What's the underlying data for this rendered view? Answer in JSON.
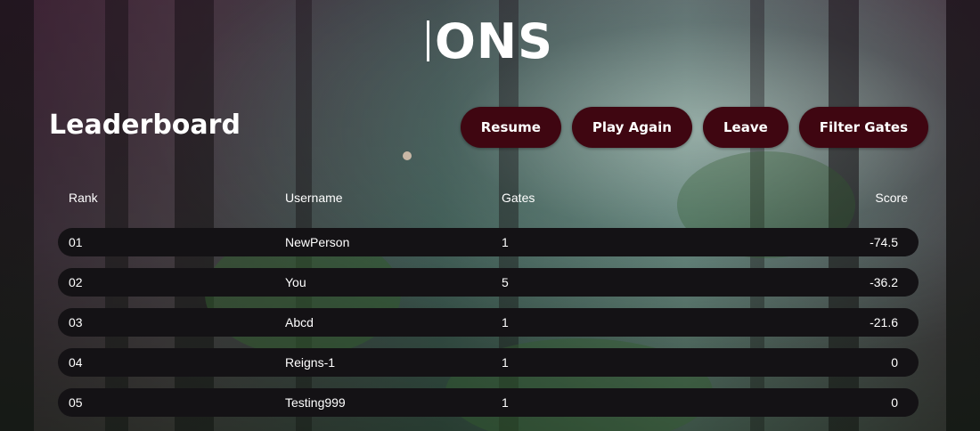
{
  "logo": {
    "text": "ONS"
  },
  "page_title": "Leaderboard",
  "buttons": {
    "resume": "Resume",
    "play_again": "Play Again",
    "leave": "Leave",
    "filter_gates": "Filter Gates"
  },
  "table": {
    "headers": {
      "rank": "Rank",
      "username": "Username",
      "gates": "Gates",
      "score": "Score"
    },
    "rows": [
      {
        "rank": "01",
        "username": "NewPerson",
        "gates": "1",
        "score": "-74.5"
      },
      {
        "rank": "02",
        "username": "You",
        "gates": "5",
        "score": "-36.2"
      },
      {
        "rank": "03",
        "username": "Abcd",
        "gates": "1",
        "score": "-21.6"
      },
      {
        "rank": "04",
        "username": "Reigns-1",
        "gates": "1",
        "score": "0"
      },
      {
        "rank": "05",
        "username": "Testing999",
        "gates": "1",
        "score": "0"
      }
    ]
  },
  "colors": {
    "button_bg": "#3f0611",
    "row_bg": "#141215",
    "text": "#ffffff"
  }
}
